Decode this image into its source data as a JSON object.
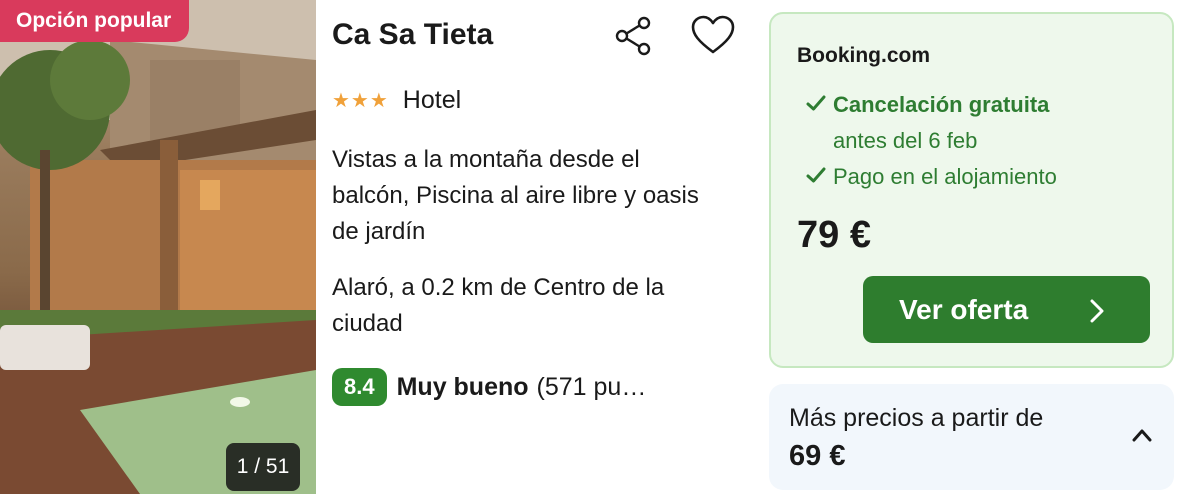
{
  "listing": {
    "badge": "Opción popular",
    "photo_counter": "1 / 51",
    "name": "Ca Sa Tieta",
    "stars": "★★★",
    "type": "Hotel",
    "features": "Vistas a la montaña desde el balcón, Piscina al aire libre y oasis de jardín",
    "location": "Alaró, a 0.2 km de Centro de la ciudad",
    "rating": {
      "score": "8.4",
      "label": "Muy bueno",
      "count": "(571 pu…"
    }
  },
  "offer": {
    "provider": "Booking.com",
    "perks": [
      {
        "title": "Cancelación gratuita",
        "detail": "antes del 6 feb"
      },
      {
        "title": "Pago en el alojamiento"
      }
    ],
    "price": "79 €",
    "cta_label": "Ver oferta"
  },
  "more_prices": {
    "label": "Más precios a partir de",
    "price": "69 €"
  },
  "colors": {
    "badge": "#d93a5c",
    "score": "#2f8a2f",
    "cta": "#2e7d2e",
    "offer_bg": "#eef8ec",
    "perk_text": "#2e7d32",
    "stars": "#f0a13a"
  },
  "icons": [
    "share-icon",
    "heart-icon",
    "check-icon",
    "chevron-right-icon",
    "chevron-up-icon"
  ]
}
